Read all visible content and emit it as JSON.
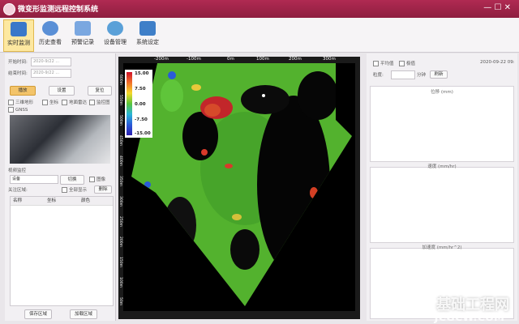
{
  "window": {
    "title": "微变形监测远程控制系统",
    "controls": "—  ☐  ✕"
  },
  "toolbar": {
    "items": [
      {
        "label": "实时监测",
        "icon": "monitor-icon",
        "color": "#3a78c9"
      },
      {
        "label": "历史查看",
        "icon": "history-icon",
        "color": "#5a8fd6"
      },
      {
        "label": "预警记录",
        "icon": "alert-log-icon",
        "color": "#7aa7e0"
      },
      {
        "label": "设备管理",
        "icon": "gear-icon",
        "color": "#5aa0d8"
      },
      {
        "label": "系统设定",
        "icon": "settings-icon",
        "color": "#3f7fc8"
      }
    ]
  },
  "left": {
    "start_label": "开始时间:",
    "start_value": "2020-9/22 ...",
    "end_label": "结束时间:",
    "end_value": "2020-9/22 ...",
    "btn_play": "播放",
    "btn_set": "设置",
    "btn_reset": "复位",
    "checks": [
      "三维地形",
      "坐标",
      "地面雷达",
      "监控图",
      "GNSS"
    ],
    "video_label": "视频监控",
    "video_select": "设备",
    "video_btn": "切换",
    "video_check": "图像",
    "area_label": "关注区域:",
    "area_check": "全部显示",
    "area_delete": "删除",
    "table_headers": [
      "名称",
      "坐标",
      "颜色"
    ],
    "btn_save": "保存区域",
    "btn_add": "加载区域"
  },
  "plot": {
    "ticks_top": [
      "-200m",
      "-100m",
      "0m",
      "100m",
      "200m",
      "300m"
    ],
    "ticks_left": [
      "600m",
      "550m",
      "500m",
      "450m",
      "400m",
      "350m",
      "300m",
      "250m",
      "200m",
      "150m",
      "100m",
      "50m"
    ],
    "colorbar": [
      "15.00",
      "7.50",
      "0.00",
      "-7.50",
      "-15.00"
    ]
  },
  "right": {
    "check1": "平均值",
    "check2": "极值",
    "period_label": "粒度:",
    "unit_label": "分钟",
    "refresh": "刷新",
    "date": "2020-09-22 09:",
    "panel1": "位移 (mm)",
    "panel2": "速度 (mm/hr)",
    "panel3": "加速度 (mm/hr^2)"
  },
  "watermark": {
    "line1": "基础工程网",
    "line2": "JCGCW.COM"
  }
}
